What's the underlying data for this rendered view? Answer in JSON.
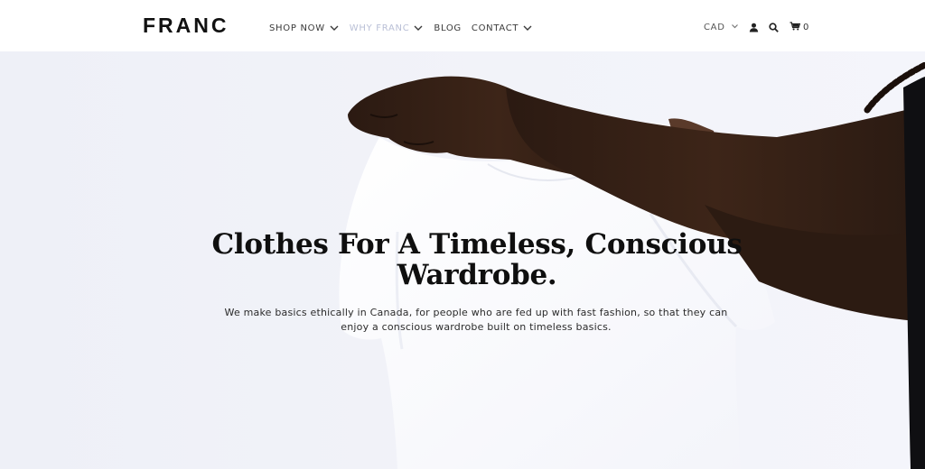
{
  "brand": {
    "logo_text": "FRANC"
  },
  "nav": {
    "items": [
      {
        "label": "SHOP NOW",
        "has_dropdown": true,
        "state": "default"
      },
      {
        "label": "WHY FRANC",
        "has_dropdown": true,
        "state": "hover"
      },
      {
        "label": "BLOG",
        "has_dropdown": false,
        "state": "default"
      },
      {
        "label": "CONTACT",
        "has_dropdown": true,
        "state": "default"
      }
    ]
  },
  "utility": {
    "currency": "CAD",
    "account_icon": "user-icon",
    "search_icon": "search-icon",
    "cart_icon": "cart-icon",
    "cart_count": "0"
  },
  "hero": {
    "headline": "Clothes For A Timeless, Conscious Wardrobe.",
    "subtext": "We make basics ethically in Canada, for people who are fed up with fast fashion, so that they can enjoy a conscious wardrobe built on timeless basics."
  },
  "colors": {
    "text_dark": "#111111",
    "nav_text": "#3a3a3a",
    "nav_hover": "#b9bfd6",
    "hero_bg": "#f0f1f8"
  }
}
